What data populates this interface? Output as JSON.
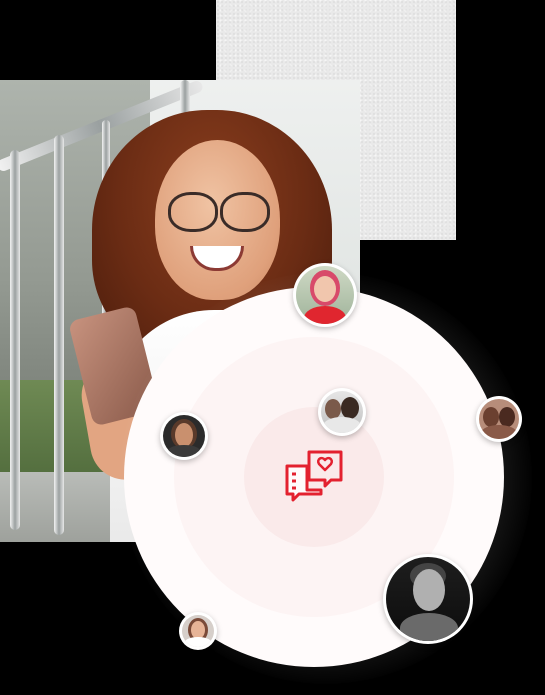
{
  "scene": {
    "description_icon": "chat-heart-icon",
    "accent_color": "#e3212f",
    "background_color": "#000000"
  },
  "avatars": [
    {
      "name": "avatar-woman-pink-hair",
      "color": "#d84a6a"
    },
    {
      "name": "avatar-two-women-selfie",
      "color": "#7a5a4a"
    },
    {
      "name": "avatar-woman-left",
      "color": "#5a3a2a"
    },
    {
      "name": "avatar-two-women-right",
      "color": "#6b4030"
    },
    {
      "name": "avatar-man-bw",
      "color": "#444444"
    },
    {
      "name": "avatar-woman-bottom",
      "color": "#7a4a38"
    }
  ]
}
